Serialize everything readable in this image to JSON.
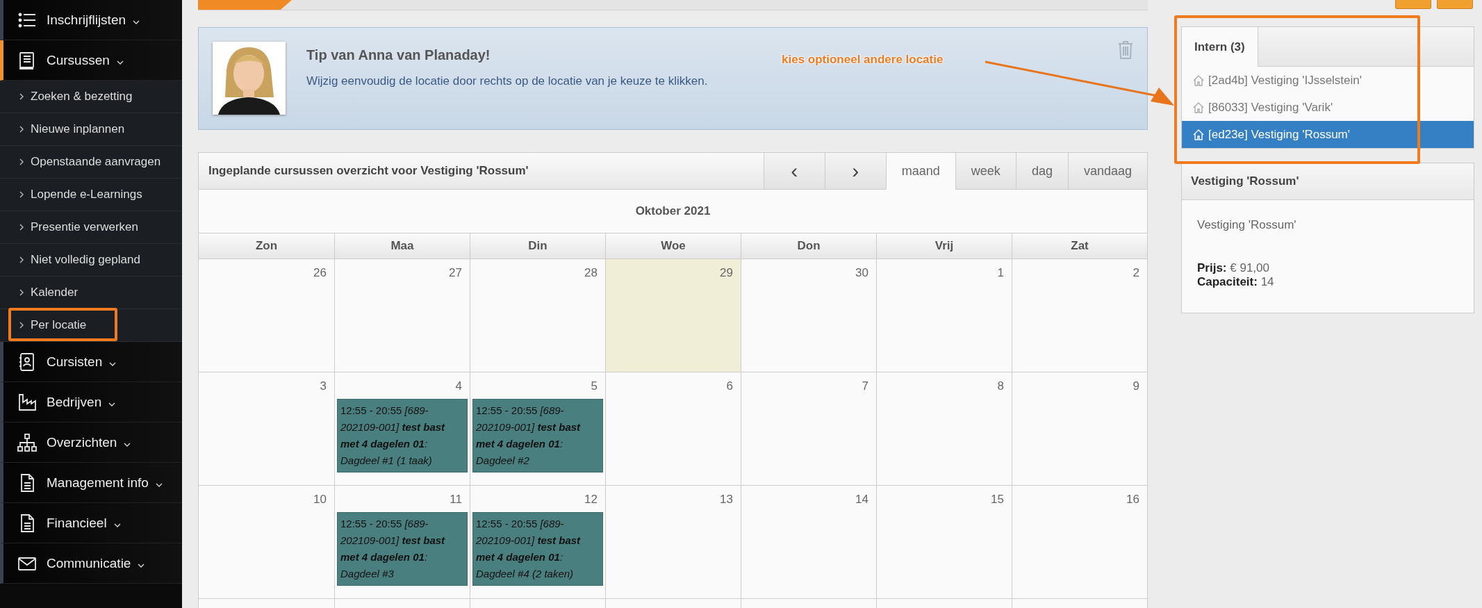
{
  "sidebar": {
    "items": [
      {
        "label": "Inschrijflijsten",
        "active": false
      },
      {
        "label": "Cursussen",
        "active": true,
        "children": [
          {
            "label": "Zoeken & bezetting"
          },
          {
            "label": "Nieuwe inplannen"
          },
          {
            "label": "Openstaande aanvragen"
          },
          {
            "label": "Lopende e-Learnings"
          },
          {
            "label": "Presentie verwerken"
          },
          {
            "label": "Niet volledig gepland"
          },
          {
            "label": "Kalender"
          },
          {
            "label": "Per locatie"
          }
        ]
      },
      {
        "label": "Cursisten",
        "active": false
      },
      {
        "label": "Bedrijven",
        "active": false
      },
      {
        "label": "Overzichten",
        "active": false
      },
      {
        "label": "Management info",
        "active": false
      },
      {
        "label": "Financieel",
        "active": false
      },
      {
        "label": "Communicatie",
        "active": false
      }
    ]
  },
  "tip": {
    "title": "Tip van Anna van Planaday!",
    "text": "Wijzig eenvoudig de locatie door rechts op de locatie van je keuze te klikken."
  },
  "annotation_label": "kies optioneel andere locatie",
  "calendar": {
    "title": "Ingeplande cursussen overzicht voor Vestiging 'Rossum'",
    "prev": "‹",
    "next": "›",
    "views": [
      {
        "label": "maand",
        "selected": true
      },
      {
        "label": "week",
        "selected": false
      },
      {
        "label": "dag",
        "selected": false
      },
      {
        "label": "vandaag",
        "selected": false
      }
    ],
    "month": "Oktober 2021",
    "weekdays": [
      "Zon",
      "Maa",
      "Din",
      "Woe",
      "Don",
      "Vrij",
      "Zat"
    ],
    "weeks": [
      {
        "days": [
          {
            "number": "26",
            "today": false
          },
          {
            "number": "27",
            "today": false
          },
          {
            "number": "28",
            "today": false
          },
          {
            "number": "29",
            "today": true
          },
          {
            "number": "30",
            "today": false
          },
          {
            "number": "1",
            "today": false
          },
          {
            "number": "2",
            "today": false
          }
        ]
      },
      {
        "days": [
          {
            "number": "3",
            "today": false
          },
          {
            "number": "4",
            "today": false,
            "events": [
              {
                "time": "12:55 - 20:55",
                "code": "[689-202109-001]",
                "course": "test bast met 4 dagelen 01",
                "detail": ": Dagdeel #1 (1 taak)"
              }
            ]
          },
          {
            "number": "5",
            "today": false,
            "events": [
              {
                "time": "12:55 - 20:55",
                "code": "[689-202109-001]",
                "course": "test bast met 4 dagelen 01",
                "detail": ": Dagdeel #2"
              }
            ]
          },
          {
            "number": "6",
            "today": false
          },
          {
            "number": "7",
            "today": false
          },
          {
            "number": "8",
            "today": false
          },
          {
            "number": "9",
            "today": false
          }
        ]
      },
      {
        "days": [
          {
            "number": "10",
            "today": false
          },
          {
            "number": "11",
            "today": false,
            "events": [
              {
                "time": "12:55 - 20:55",
                "code": "[689-202109-001]",
                "course": "test bast met 4 dagelen 01",
                "detail": ": Dagdeel #3"
              }
            ]
          },
          {
            "number": "12",
            "today": false,
            "events": [
              {
                "time": "12:55 - 20:55",
                "code": "[689-202109-001]",
                "course": "test bast met 4 dagelen 01",
                "detail": ": Dagdeel #4 (2 taken)"
              }
            ]
          },
          {
            "number": "13",
            "today": false
          },
          {
            "number": "14",
            "today": false
          },
          {
            "number": "15",
            "today": false
          },
          {
            "number": "16",
            "today": false
          }
        ]
      }
    ]
  },
  "locations": {
    "tabs": [
      {
        "label": "Intern (3)",
        "selected": true
      }
    ],
    "items": [
      {
        "label": "[2ad4b] Vestiging 'IJsselstein'",
        "selected": false
      },
      {
        "label": "[86033] Vestiging 'Varik'",
        "selected": false
      },
      {
        "label": "[ed23e] Vestiging 'Rossum'",
        "selected": true
      }
    ]
  },
  "location_detail": {
    "title": "Vestiging 'Rossum'",
    "name": "Vestiging 'Rossum'",
    "fields": [
      {
        "label": "Prijs:",
        "value": "€ 91,00"
      },
      {
        "label": "Capaciteit:",
        "value": "14"
      }
    ]
  }
}
